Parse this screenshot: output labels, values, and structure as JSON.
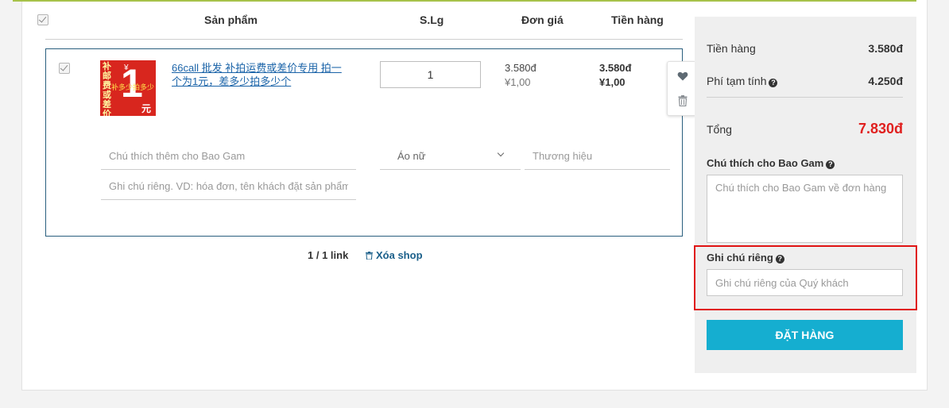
{
  "cart": {
    "headers": {
      "product": "Sản phẩm",
      "qty": "S.Lg",
      "unit_price": "Đơn giá",
      "amount": "Tiền hàng"
    },
    "item": {
      "title": "66call 批发 补拍运费或差价专用 拍一个为1元，差多少拍多少个",
      "quantity": "1",
      "unit_price_vnd": "3.580đ",
      "unit_price_cny": "¥1,00",
      "amount_vnd": "3.580đ",
      "amount_cny": "¥1,00",
      "note_placeholder": "Chú thích thêm cho Bao Gam",
      "private_note_placeholder": "Ghi chú riêng. VD: hóa đơn, tên khách đặt sản phẩm",
      "category": "Áo nữ",
      "brand_placeholder": "Thương hiệu",
      "thumbnail_text": {
        "side": "补邮费或差价",
        "big": "1",
        "mid": "补多少拍多少",
        "unit": "元",
        "symbol": "¥"
      }
    },
    "links_count": "1 / 1 link",
    "delete_shop": "Xóa shop"
  },
  "summary": {
    "goods_label": "Tiền hàng",
    "goods_value": "3.580đ",
    "temp_fee_label": "Phí tạm tính",
    "temp_fee_value": "4.250đ",
    "total_label": "Tổng",
    "total_value": "7.830đ",
    "note_label": "Chú thích cho Bao Gam",
    "note_placeholder": "Chú thích cho Bao Gam về đơn hàng",
    "private_label": "Ghi chú riêng",
    "private_placeholder": "Ghi chú riêng của Quý khách",
    "order_button": "ĐẶT HÀNG",
    "help_glyph": "?"
  },
  "colors": {
    "accent": "#15aed0",
    "total": "#e0201f",
    "highlight": "#e01313",
    "link": "#1a63a8",
    "top_border": "#a7c24a"
  }
}
